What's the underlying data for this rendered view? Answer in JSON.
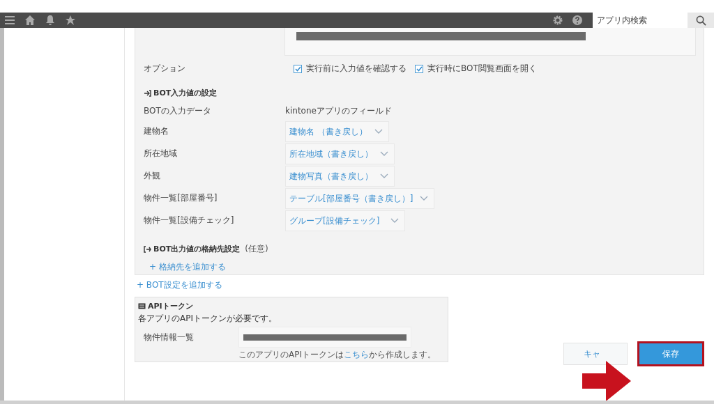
{
  "header": {
    "search": {
      "placeholder": "アプリ内検索"
    }
  },
  "options": {
    "label": "オプション",
    "items": [
      {
        "label": "実行前に入力値を確認する",
        "checked": true
      },
      {
        "label": "実行時にBOT閲覧画面を開く",
        "checked": true
      }
    ]
  },
  "input_section": {
    "title": "BOT入力値の設定",
    "column_1": "BOTの入力データ",
    "column_2": "kintoneアプリのフィールド",
    "rows": [
      {
        "label": "建物名",
        "value": "建物名 （書き戻し）"
      },
      {
        "label": "所在地域",
        "value": "所在地域（書き戻し）"
      },
      {
        "label": "外観",
        "value": "建物写真（書き戻し）"
      },
      {
        "label": "物件一覧[部屋番号]",
        "value": "テーブル[部屋番号（書き戻し）]"
      },
      {
        "label": "物件一覧[設備チェック]",
        "value": "グループ[設備チェック]"
      }
    ]
  },
  "output_section": {
    "title": "BOT出力値の格納先設定",
    "note": "(任意)",
    "add_link": "+ 格納先を追加する"
  },
  "add_bot_link": "+ BOT設定を追加する",
  "api_token": {
    "title": "APIトークン",
    "description": "各アプリのAPIトークンが必要です。",
    "field_label": "物件情報一覧",
    "hint": {
      "before": "このアプリのAPIトークンは",
      "link": "こちら",
      "after": "から作成します。"
    }
  },
  "buttons": {
    "cancel": "キャ",
    "save": "保存"
  }
}
